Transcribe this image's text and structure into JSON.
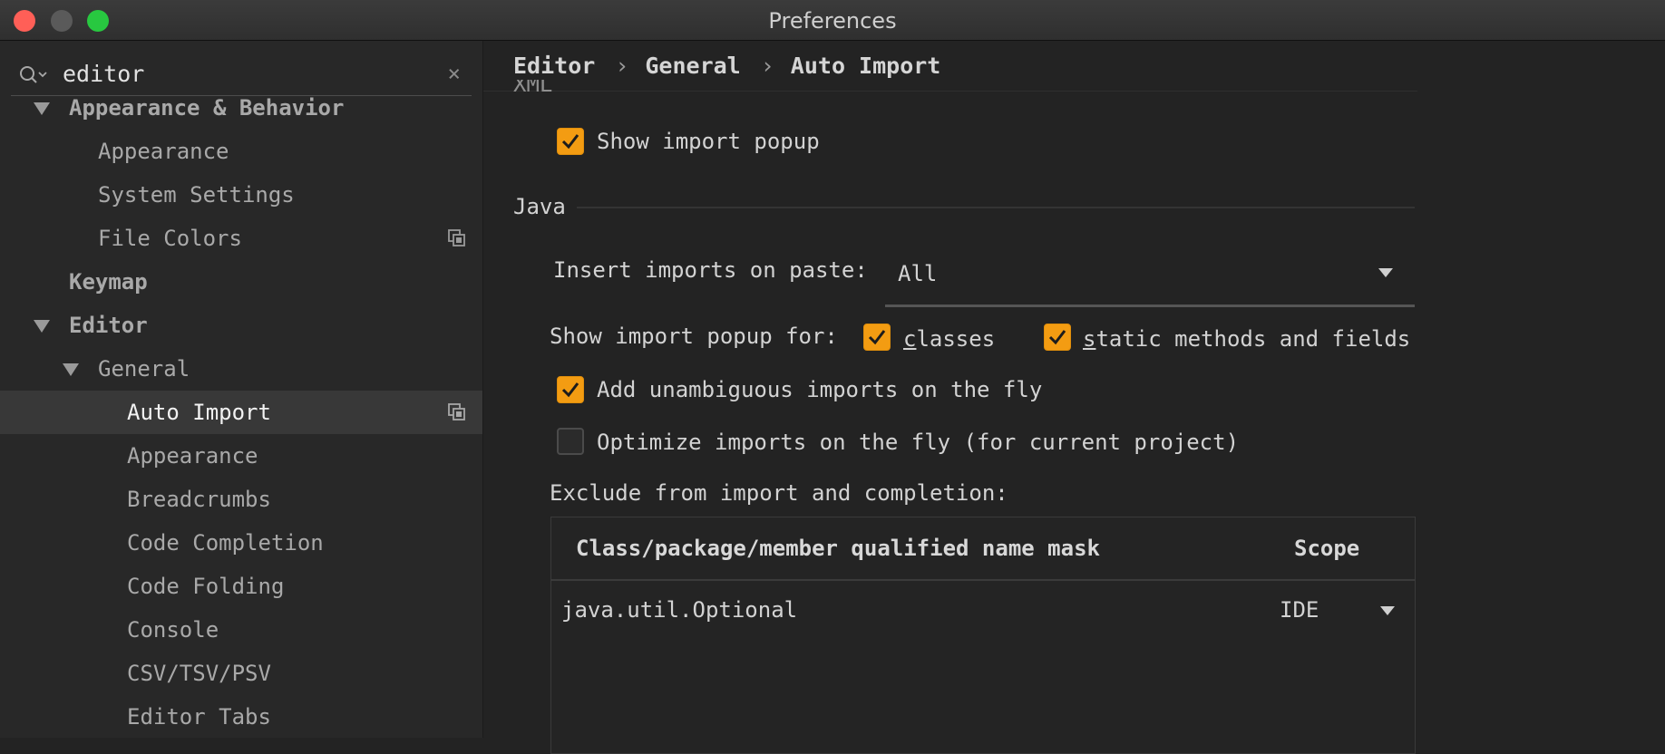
{
  "window": {
    "title": "Preferences"
  },
  "search": {
    "value": "editor",
    "icon": "search-icon",
    "clear": "×"
  },
  "sidebar": {
    "items": [
      {
        "label": "Appearance & Behavior",
        "expanded": true,
        "bold": true
      },
      {
        "label": "Appearance"
      },
      {
        "label": "System Settings"
      },
      {
        "label": "File Colors",
        "project_icon": true
      },
      {
        "label": "Keymap",
        "bold": true
      },
      {
        "label": "Editor",
        "expanded": true,
        "bold": true
      },
      {
        "label": "General",
        "expanded": true
      },
      {
        "label": "Auto Import",
        "selected": true,
        "project_icon": true
      },
      {
        "label": "Appearance"
      },
      {
        "label": "Breadcrumbs"
      },
      {
        "label": "Code Completion"
      },
      {
        "label": "Code Folding"
      },
      {
        "label": "Console"
      },
      {
        "label": "CSV/TSV/PSV"
      },
      {
        "label": "Editor Tabs"
      }
    ]
  },
  "breadcrumb": {
    "items": [
      "Editor",
      "General",
      "Auto Import"
    ],
    "separator": "›"
  },
  "xml_section": {
    "title": "XML",
    "show_import_popup": {
      "label": "Show import popup",
      "checked": true
    }
  },
  "java_section": {
    "title": "Java",
    "insert_imports": {
      "label": "Insert imports on paste:",
      "value": "All"
    },
    "show_popup_for": {
      "label": "Show import popup for:",
      "classes": {
        "label_first": "c",
        "label_rest": "lasses",
        "checked": true
      },
      "static": {
        "label_first": "s",
        "label_rest": "tatic methods and fields",
        "checked": true
      }
    },
    "add_unambiguous": {
      "label": "Add unambiguous imports on the fly",
      "checked": true
    },
    "optimize_imports": {
      "label": "Optimize imports on the fly (for current project)",
      "checked": false
    },
    "exclude_label": "Exclude from import and completion:",
    "table": {
      "headers": [
        "Class/package/member qualified name mask",
        "Scope"
      ],
      "rows": [
        {
          "mask": "java.util.Optional",
          "scope": "IDE"
        }
      ]
    }
  },
  "colors": {
    "accent": "#f39c12",
    "background": "#232323",
    "sidebar": "#282828",
    "selected": "#383838"
  }
}
